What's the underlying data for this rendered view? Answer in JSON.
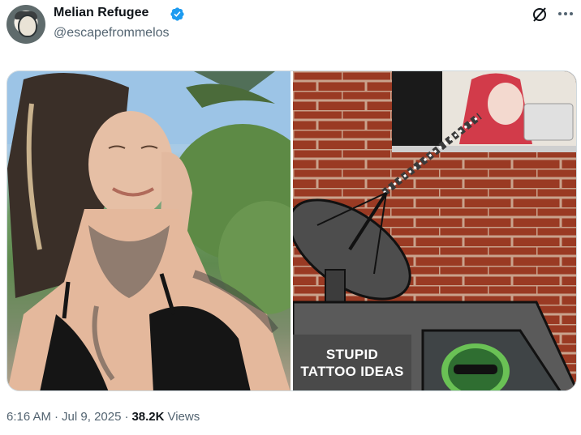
{
  "author": {
    "display_name": "Melian Refugee",
    "handle": "@escapefrommelos",
    "verified": true
  },
  "icons": {
    "verified": "verified-badge-icon",
    "grok": "grok-icon",
    "more": "more-horizontal-icon"
  },
  "media": {
    "right_caption": [
      "STUPID",
      "TATTOO IDEAS"
    ]
  },
  "meta": {
    "time": "6:16 AM",
    "date": "Jul 9, 2025",
    "separator": "·",
    "views_count": "38.2K",
    "views_label": "Views"
  },
  "colors": {
    "verified_blue": "#1d9bf0",
    "text_primary": "#0f1419",
    "text_secondary": "#536471",
    "brick": "#9a3a23",
    "mortar": "#c9a28c"
  }
}
